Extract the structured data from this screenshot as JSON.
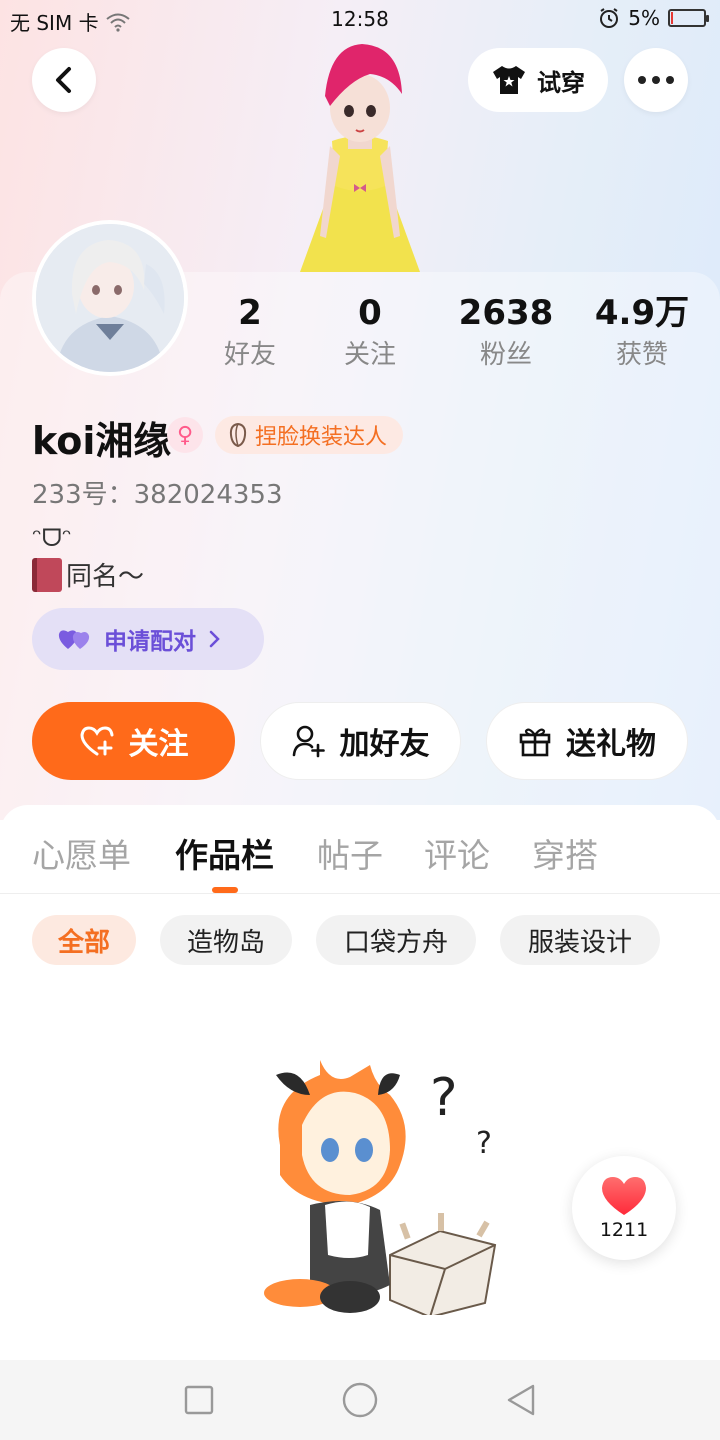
{
  "status_bar": {
    "carrier": "无 SIM 卡",
    "time": "12:58",
    "battery": "5%",
    "battery_level": 0.05
  },
  "header": {
    "tryon_label": "试穿"
  },
  "profile": {
    "stats": [
      {
        "value": "2",
        "label": "好友"
      },
      {
        "value": "0",
        "label": "关注"
      },
      {
        "value": "2638",
        "label": "粉丝"
      },
      {
        "value": "4.9万",
        "label": "获赞"
      }
    ],
    "nickname": "koi湘缘",
    "gender_symbol": "♀",
    "title_badge": "捏脸换装达人",
    "uid": "233号：382024353",
    "bio_line1": "ᵔᗜᵔ",
    "bio_line2": "同名～",
    "pair_label": "申请配对"
  },
  "actions": {
    "follow": "关注",
    "add_friend": "加好友",
    "gift": "送礼物"
  },
  "tabs": [
    "心愿单",
    "作品栏",
    "帖子",
    "评论",
    "穿搭"
  ],
  "active_tab": "作品栏",
  "filters": [
    "全部",
    "造物岛",
    "口袋方舟",
    "服装设计"
  ],
  "active_filter": "全部",
  "likes": {
    "count": "1211"
  },
  "colors": {
    "accent": "#ff6a1a",
    "pair_purple": "#6b4fd8",
    "gender_pink": "#ff5a8a"
  }
}
